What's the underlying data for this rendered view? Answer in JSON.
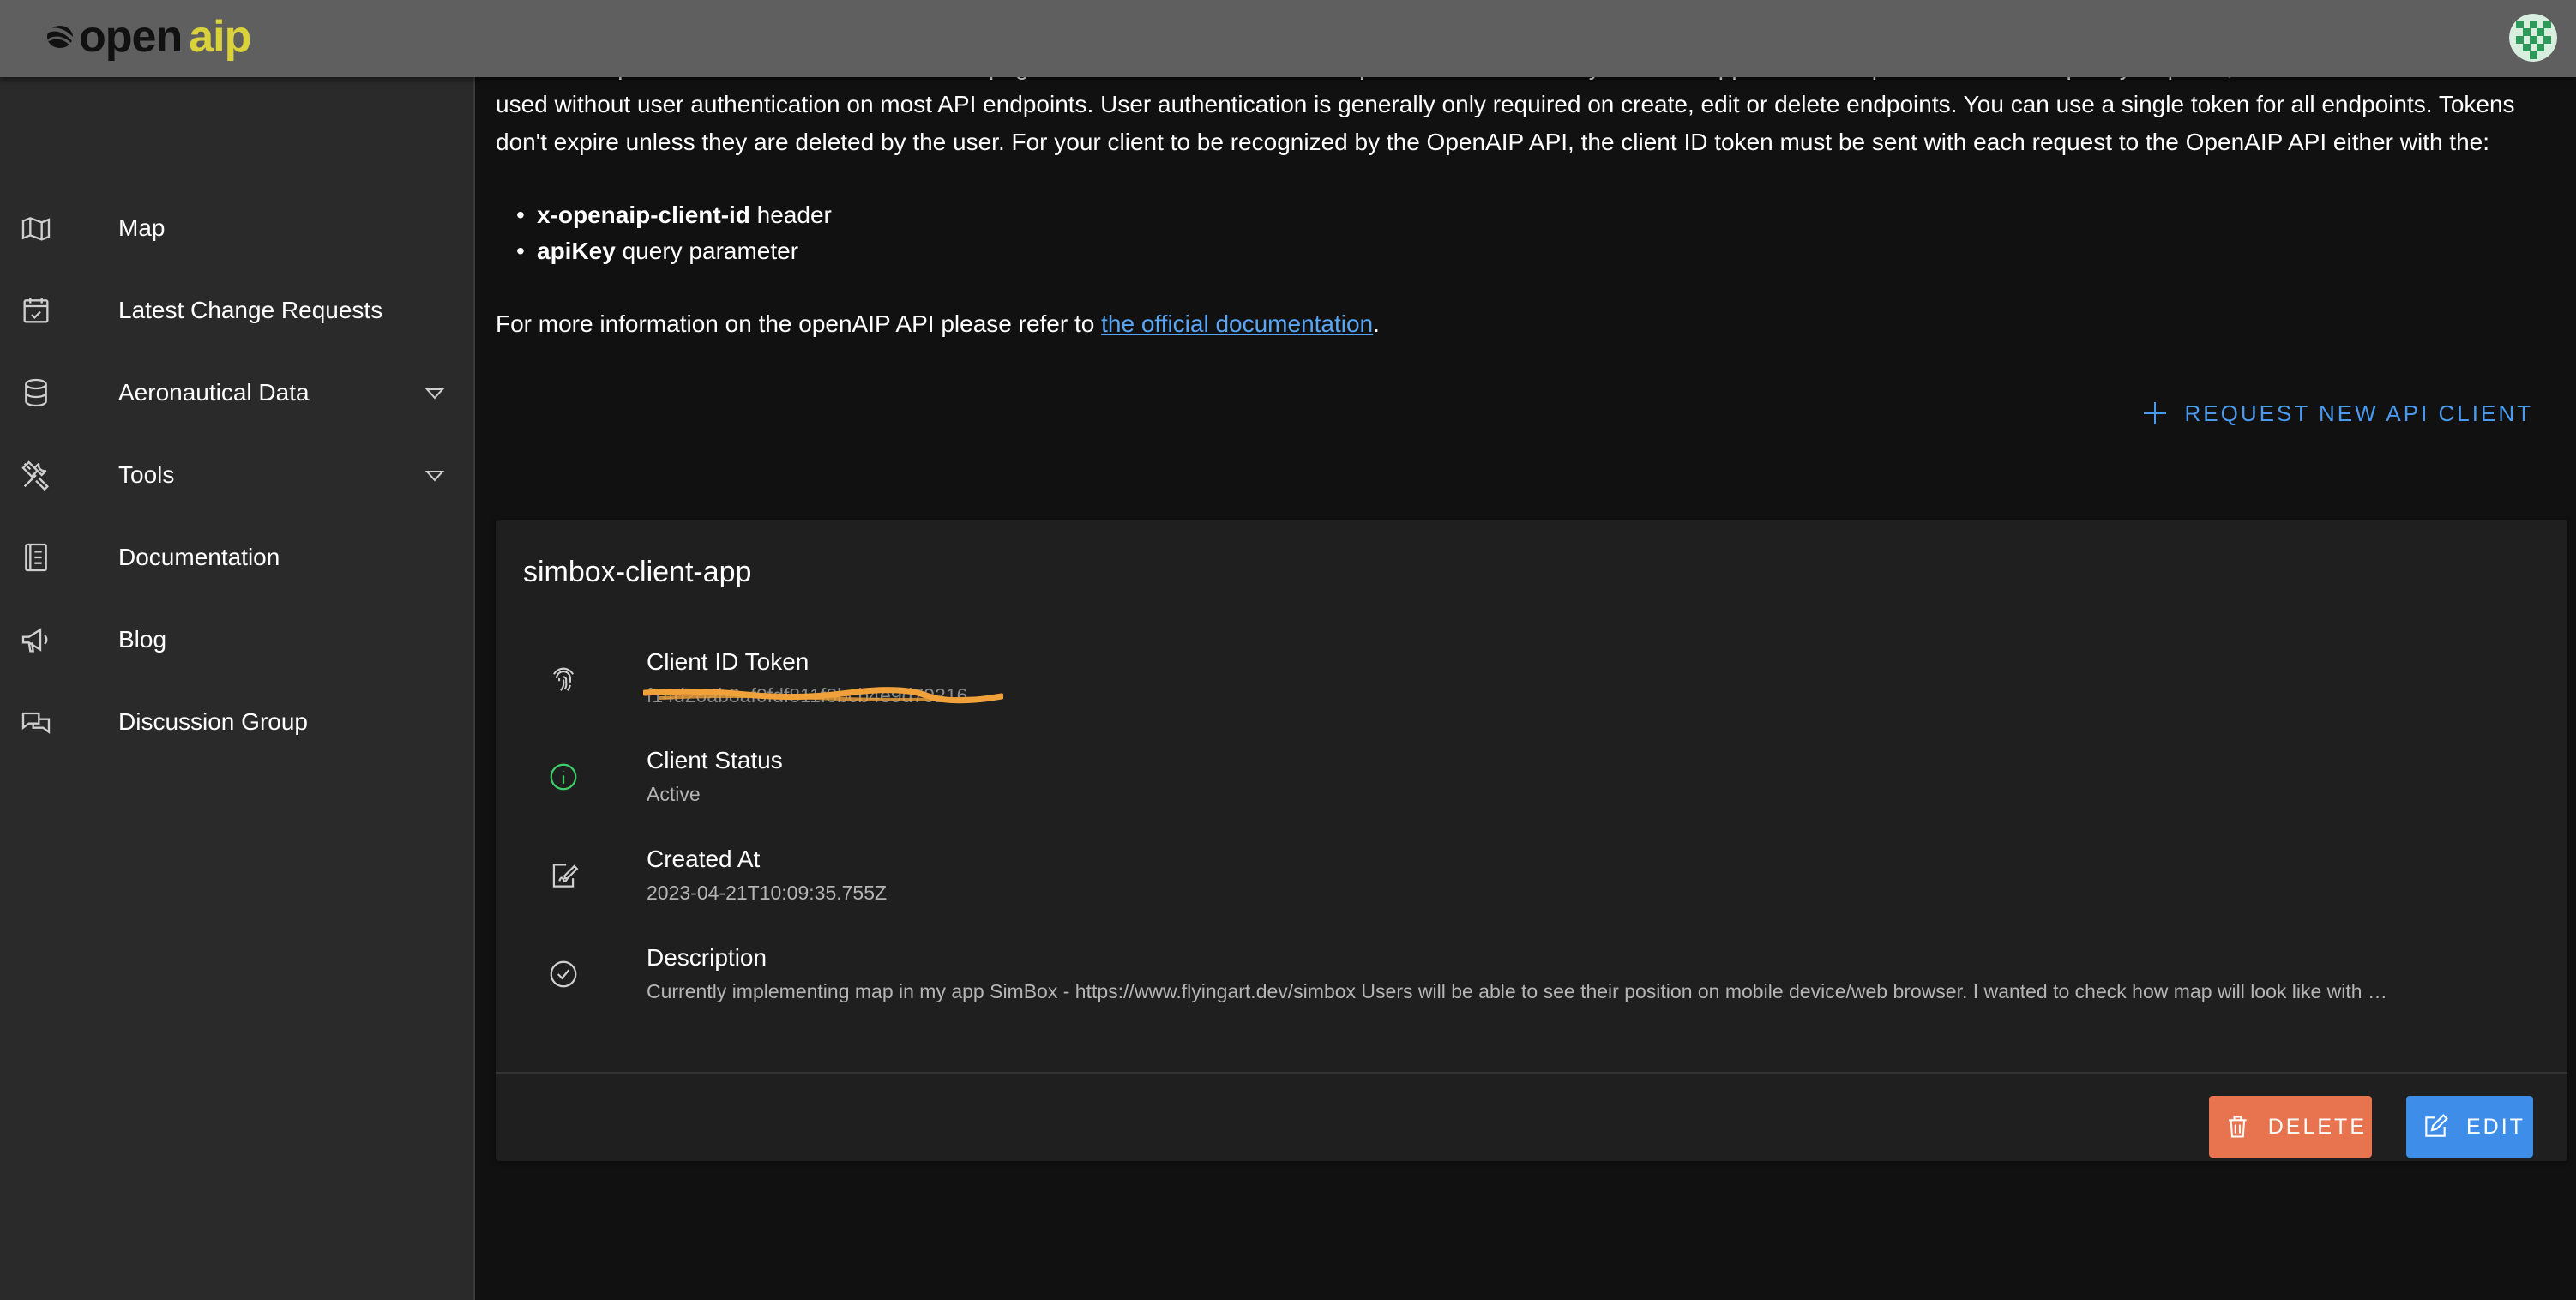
{
  "header": {
    "logo_open": "open",
    "logo_aip": "aip"
  },
  "sidebar": {
    "items": [
      {
        "label": "Map",
        "icon": "map-icon"
      },
      {
        "label": "Latest Change Requests",
        "icon": "calendar-check-icon"
      },
      {
        "label": "Aeronautical Data",
        "icon": "database-icon",
        "expandable": true
      },
      {
        "label": "Tools",
        "icon": "tools-icon",
        "expandable": true
      },
      {
        "label": "Documentation",
        "icon": "book-icon"
      },
      {
        "label": "Blog",
        "icon": "megaphone-icon"
      },
      {
        "label": "Discussion Group",
        "icon": "chat-icon"
      }
    ]
  },
  "main": {
    "intro_text": "You can request an API client ID token on this page. The API client ID token is required to authenticate your client application to OpenAIP. Unless explicitly required, the client ID token can be used without user authentication on most API endpoints. User authentication is generally only required on create, edit or delete endpoints. You can use a single token for all endpoints. Tokens don't expire unless they are deleted by the user. For your client to be recognized by the OpenAIP API, the client ID token must be sent with each request to the OpenAIP API either with the:",
    "bullets": [
      {
        "bold": "x-openaip-client-id",
        "rest": " header"
      },
      {
        "bold": "apiKey",
        "rest": " query parameter"
      }
    ],
    "more_prefix": "For more information on the openAIP API please refer to ",
    "more_link": "the official documentation",
    "more_suffix": ".",
    "request_button": "REQUEST NEW API CLIENT"
  },
  "client_card": {
    "title": "simbox-client-app",
    "rows": [
      {
        "label": "Client ID Token",
        "value": "f14d20ab8af0fdf811f8bcb4e9d79216",
        "icon": "fingerprint-icon"
      },
      {
        "label": "Client Status",
        "value": "Active",
        "icon": "info-icon"
      },
      {
        "label": "Created At",
        "value": "2023-04-21T10:09:35.755Z",
        "icon": "signature-icon"
      },
      {
        "label": "Description",
        "value": "Currently implementing map in my app SimBox - https://www.flyingart.dev/simbox Users will be able to see their position on mobile device/web browser. I wanted to check how map will look like with …",
        "icon": "check-circle-icon"
      }
    ],
    "delete_label": "DELETE",
    "edit_label": "EDIT"
  },
  "colors": {
    "accent_blue": "#3e8ee9",
    "link_blue": "#58a6f5",
    "delete_orange": "#e8734f",
    "logo_yellow": "#d9d23a",
    "status_green": "#3ecf6a",
    "redaction_orange": "#f0a13a"
  }
}
